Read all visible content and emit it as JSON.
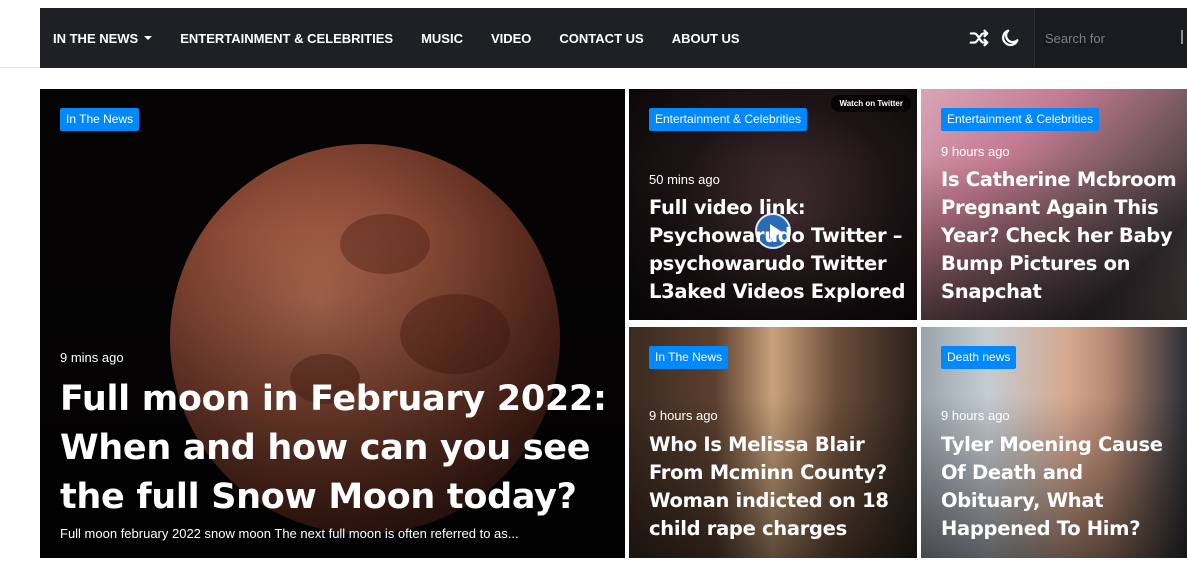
{
  "nav": {
    "items": [
      {
        "label": "In The News",
        "has_dropdown": true
      },
      {
        "label": "Entertainment & Celebrities",
        "has_dropdown": false
      },
      {
        "label": "Music",
        "has_dropdown": false
      },
      {
        "label": "Video",
        "has_dropdown": false
      },
      {
        "label": "Contact Us",
        "has_dropdown": false
      },
      {
        "label": "About Us",
        "has_dropdown": false
      }
    ],
    "icons": [
      "shuffle-icon",
      "moon-icon"
    ],
    "search_placeholder": "Search for"
  },
  "featured": {
    "category": "In The News",
    "time": "9 mins ago",
    "title": "Full moon in February 2022: When and how can you see the full Snow Moon today?",
    "excerpt": "Full moon february 2022 snow moon The next full moon is often referred to as..."
  },
  "posts": [
    {
      "category": "Entertainment & Celebrities",
      "time": "50 mins ago",
      "title": "Full video link: Psychowarudo Twitter – psychowarudo Twitter L3aked Videos Explored",
      "overlay": "Watch on Twitter"
    },
    {
      "category": "Entertainment & Celebrities",
      "time": "9 hours ago",
      "title": "Is Catherine Mcbroom Pregnant Again This Year? Check her Baby Bump Pictures on Snapchat"
    },
    {
      "category": "In The News",
      "time": "9 hours ago",
      "title": "Who Is Melissa Blair From Mcminn County? Woman indicted on 18 child rape charges"
    },
    {
      "category": "Death news",
      "time": "9 hours ago",
      "title": "Tyler Moening Cause Of Death and Obituary, What Happened To Him?"
    }
  ],
  "colors": {
    "nav_bg": "#1f2024",
    "badge_bg": "#0088ff",
    "text": "#ffffff"
  }
}
